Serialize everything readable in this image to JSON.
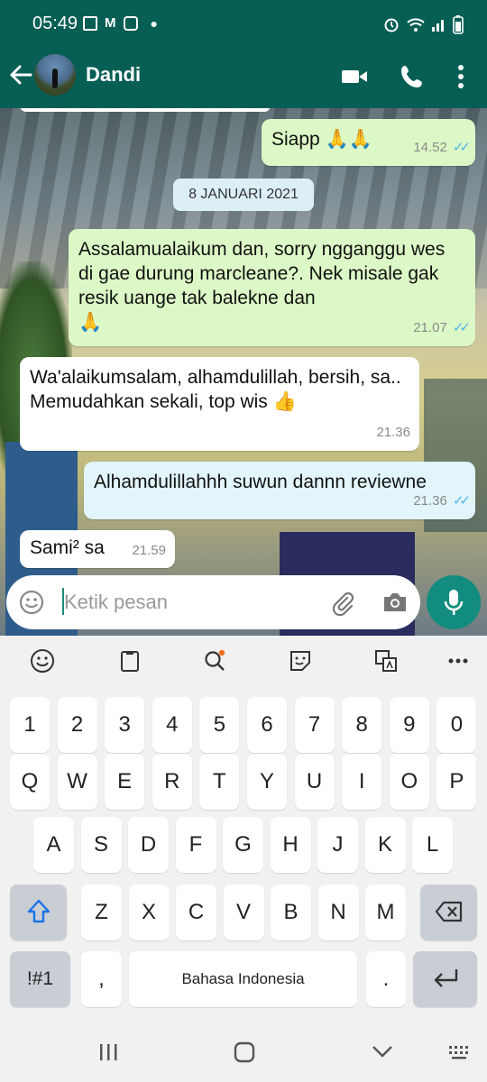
{
  "status_bar": {
    "time": "05:49"
  },
  "header": {
    "contact_name": "Dandi"
  },
  "chat": {
    "messages": [
      {
        "text": "Siapp",
        "emoji": "🙏🙏",
        "time": "14.52",
        "direction": "out",
        "read": true
      },
      {
        "text": "Assalamualaikum dan, sorry ngganggu wes di gae durung marcleane?. Nek misale gak resik uange tak balekne dan",
        "emoji": "🙏",
        "time": "21.07",
        "direction": "out",
        "read": true
      },
      {
        "text_line1": "Wa'alaikumsalam, alhamdulillah, bersih, sa..",
        "text_line2": "Memudahkan sekali, top wis",
        "emoji": "👍",
        "time": "21.36",
        "direction": "in"
      },
      {
        "text": "Alhamdulillahhh suwun dannn reviewne",
        "time": "21.36",
        "direction": "out",
        "read": true
      },
      {
        "text": "Sami² sa",
        "time": "21.59",
        "direction": "in"
      }
    ],
    "date_separator": "8 JANUARI 2021"
  },
  "composer": {
    "placeholder": "Ketik pesan"
  },
  "keyboard": {
    "number_row": [
      "1",
      "2",
      "3",
      "4",
      "5",
      "6",
      "7",
      "8",
      "9",
      "0"
    ],
    "row1": [
      "Q",
      "W",
      "E",
      "R",
      "T",
      "Y",
      "U",
      "I",
      "O",
      "P"
    ],
    "row2": [
      "A",
      "S",
      "D",
      "F",
      "G",
      "H",
      "J",
      "K",
      "L"
    ],
    "row3": [
      "Z",
      "X",
      "C",
      "V",
      "B",
      "N",
      "M"
    ],
    "symbols_key": "!#1",
    "comma_key": ",",
    "space_label": "Bahasa Indonesia",
    "period_key": "."
  },
  "colors": {
    "header": "#075e54",
    "outgoing_bubble": "#dcf8c6",
    "incoming_bubble": "#ffffff",
    "mic_button": "#128c7e",
    "read_ticks": "#4fb6ec"
  }
}
